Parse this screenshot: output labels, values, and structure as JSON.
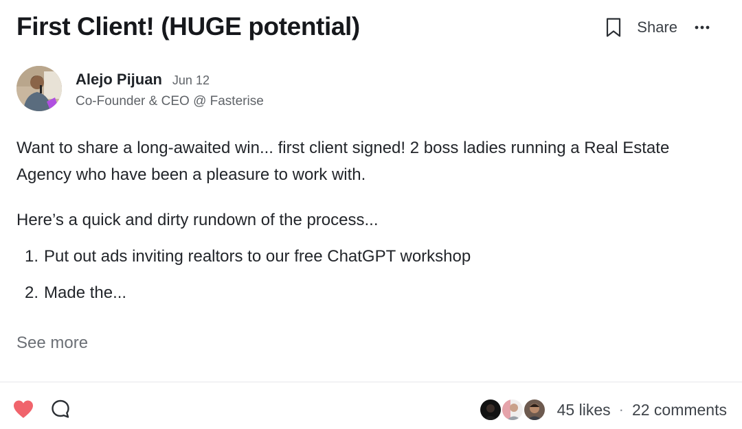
{
  "post": {
    "title": "First Client! (HUGE potential)",
    "actions": {
      "bookmark_icon": "bookmark-icon",
      "share_label": "Share",
      "more_icon": "ellipsis-icon"
    },
    "author": {
      "name": "Alejo Pijuan",
      "date": "Jun 12",
      "role": "Co-Founder & CEO @ Fasterise"
    },
    "body": {
      "paragraphs": [
        "Want to share a long-awaited win... first client signed! 2 boss ladies running a Real Estate Agency who have been a pleasure to work with.",
        "Here’s a quick and dirty rundown of the process..."
      ],
      "list": [
        {
          "num": "1.",
          "text": "Put out ads inviting realtors to our free ChatGPT workshop"
        },
        {
          "num": "2.",
          "text": "Made the..."
        }
      ]
    },
    "see_more_label": "See more",
    "footer": {
      "like_icon": "heart-icon",
      "comment_icon": "comment-icon",
      "likes_label": "45 likes",
      "separator": "·",
      "comments_label": "22 comments"
    }
  },
  "colors": {
    "heart": "#f0646c",
    "text_primary": "#1f2328",
    "text_secondary": "#5f6368"
  }
}
